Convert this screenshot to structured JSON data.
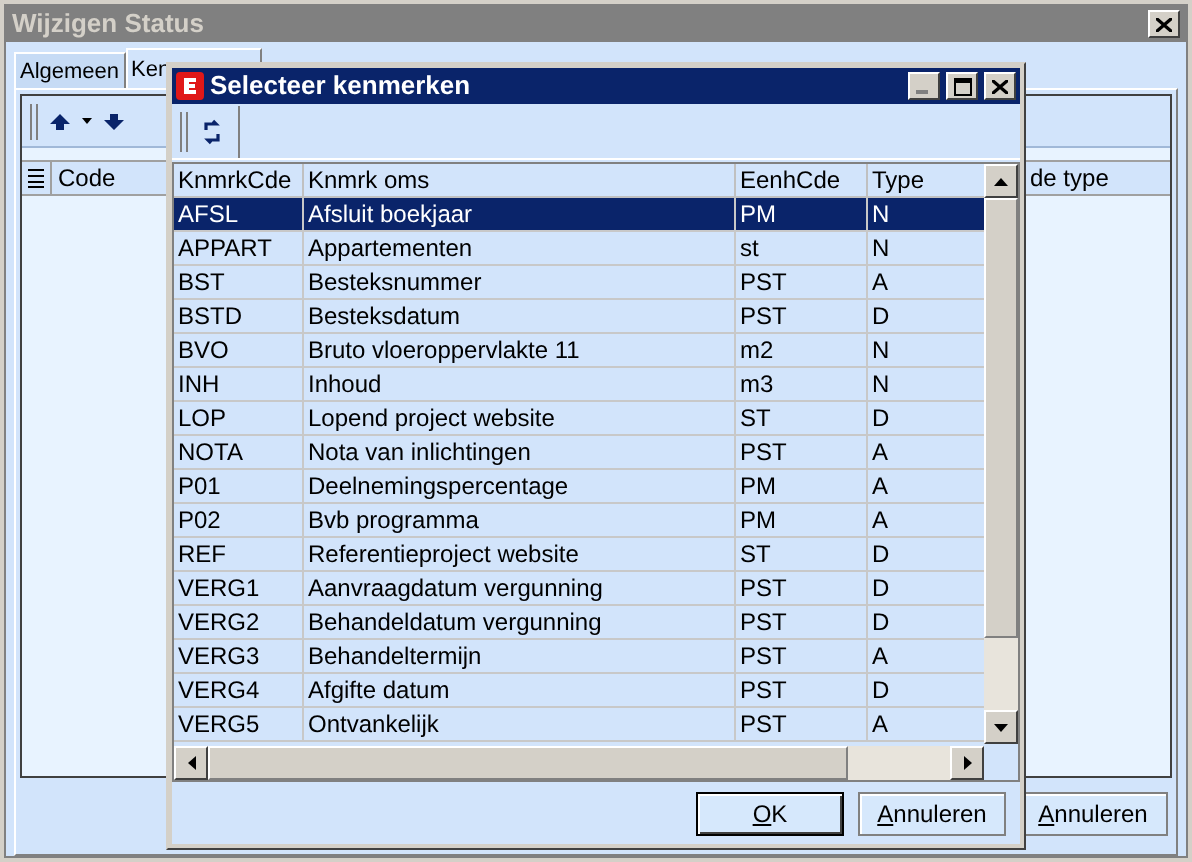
{
  "window": {
    "title": "Wijzigen Status"
  },
  "tabs": [
    {
      "label": "Algemeen",
      "selected": false
    },
    {
      "label": "Ken",
      "selected": true
    }
  ],
  "grid": {
    "columns": [
      "Code",
      "de type"
    ]
  },
  "buttons": [
    {
      "label": "Annuleren",
      "default": false
    }
  ],
  "dialog": {
    "title": "Selecteer kenmerken",
    "table": {
      "columns": [
        "KnmrkCde",
        "Knmrk oms",
        "EenhCde",
        "Type"
      ],
      "rows": [
        {
          "cells": [
            "AFSL",
            "Afsluit boekjaar",
            "PM",
            "N"
          ],
          "selected": true
        },
        {
          "cells": [
            "APPART",
            "Appartementen",
            "st",
            "N"
          ],
          "selected": false
        },
        {
          "cells": [
            "BST",
            "Besteksnummer",
            "PST",
            "A"
          ],
          "selected": false
        },
        {
          "cells": [
            "BSTD",
            "Besteksdatum",
            "PST",
            "D"
          ],
          "selected": false
        },
        {
          "cells": [
            "BVO",
            "Bruto vloeroppervlakte 11",
            "m2",
            "N"
          ],
          "selected": false
        },
        {
          "cells": [
            "INH",
            "Inhoud",
            "m3",
            "N"
          ],
          "selected": false
        },
        {
          "cells": [
            "LOP",
            "Lopend project website",
            "ST",
            "D"
          ],
          "selected": false
        },
        {
          "cells": [
            "NOTA",
            "Nota van inlichtingen",
            "PST",
            "A"
          ],
          "selected": false
        },
        {
          "cells": [
            "P01",
            "Deelnemingspercentage",
            "PM",
            "A"
          ],
          "selected": false
        },
        {
          "cells": [
            "P02",
            "Bvb programma",
            "PM",
            "A"
          ],
          "selected": false
        },
        {
          "cells": [
            "REF",
            "Referentieproject website",
            "ST",
            "D"
          ],
          "selected": false
        },
        {
          "cells": [
            "VERG1",
            "Aanvraagdatum vergunning",
            "PST",
            "D"
          ],
          "selected": false
        },
        {
          "cells": [
            "VERG2",
            "Behandeldatum vergunning",
            "PST",
            "D"
          ],
          "selected": false
        },
        {
          "cells": [
            "VERG3",
            "Behandeltermijn",
            "PST",
            "A"
          ],
          "selected": false
        },
        {
          "cells": [
            "VERG4",
            "Afgifte datum",
            "PST",
            "D"
          ],
          "selected": false
        },
        {
          "cells": [
            "VERG5",
            "Ontvankelijk",
            "PST",
            "A"
          ],
          "selected": false
        }
      ]
    },
    "buttons": [
      {
        "label": "OK",
        "default": true
      },
      {
        "label": "Annuleren",
        "default": false
      }
    ]
  }
}
